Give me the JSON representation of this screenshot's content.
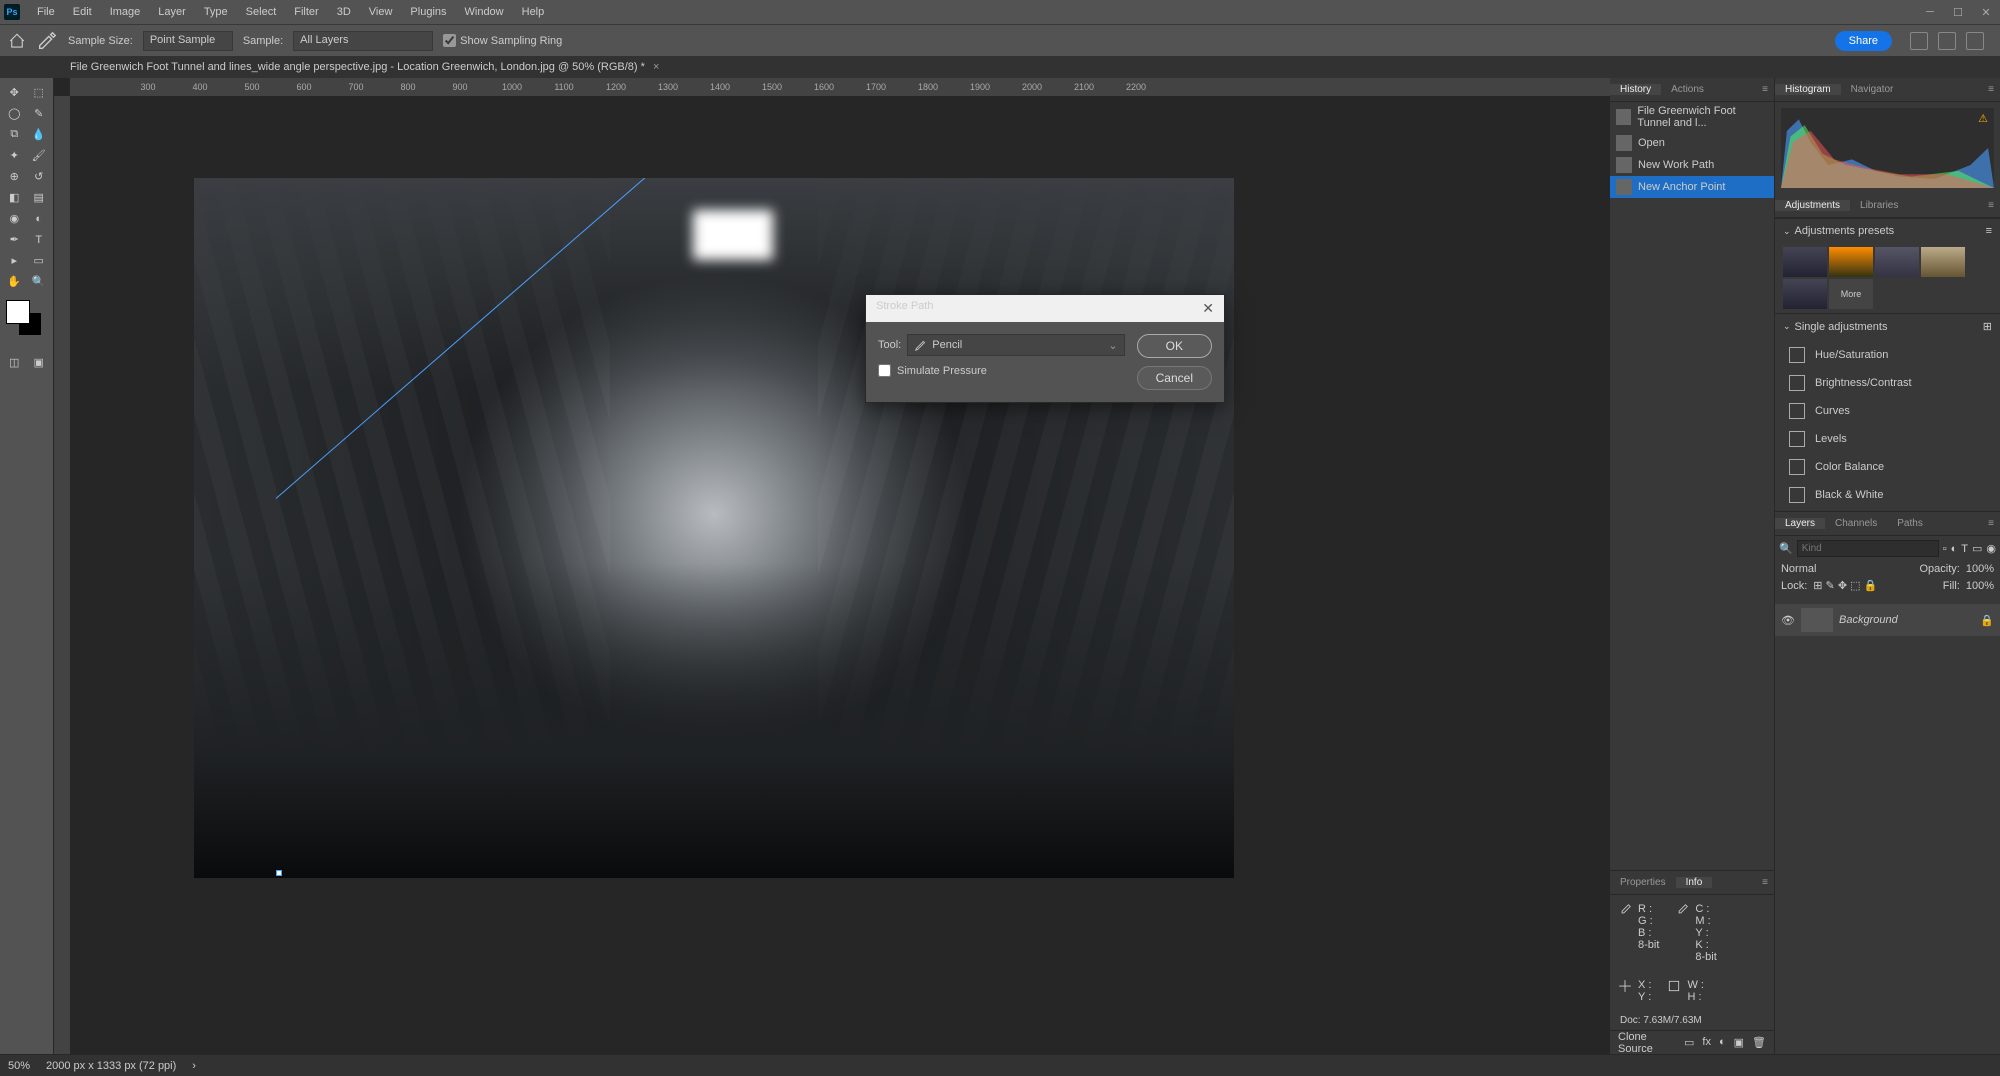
{
  "menu": {
    "items": [
      "File",
      "Edit",
      "Image",
      "Layer",
      "Type",
      "Select",
      "Filter",
      "3D",
      "View",
      "Plugins",
      "Window",
      "Help"
    ]
  },
  "optbar": {
    "sample_size_label": "Sample Size:",
    "sample_size_value": "Point Sample",
    "sample_label": "Sample:",
    "sample_value": "All Layers",
    "show_ring": "Show Sampling Ring",
    "share": "Share"
  },
  "doc": {
    "title": "File Greenwich Foot Tunnel and lines_wide angle perspective.jpg - Location Greenwich, London.jpg @ 50% (RGB/8) *"
  },
  "ruler_marks": [
    "",
    "300",
    "400",
    "500",
    "600",
    "700",
    "800",
    "900",
    "1000",
    "1100",
    "1200",
    "1300",
    "1400",
    "1500",
    "1600",
    "1700",
    "1800",
    "1900",
    "2000",
    "2100",
    "2200"
  ],
  "dialog": {
    "title": "Stroke Path",
    "tool_label": "Tool:",
    "tool_value": "Pencil",
    "simulate": "Simulate Pressure",
    "ok": "OK",
    "cancel": "Cancel"
  },
  "panels": {
    "history_tab": "History",
    "actions_tab": "Actions",
    "histogram_tab": "Histogram",
    "navigator_tab": "Navigator",
    "adjustments_tab": "Adjustments",
    "libraries_tab": "Libraries",
    "properties_tab": "Properties",
    "info_tab": "Info",
    "layers_tab": "Layers",
    "channels_tab": "Channels",
    "paths_tab": "Paths",
    "clone_source": "Clone Source"
  },
  "history": {
    "file": "File Greenwich Foot Tunnel and l...",
    "items": [
      "Open",
      "New Work Path",
      "New Anchor Point"
    ]
  },
  "adj_presets_hdr": "Adjustments presets",
  "single_adj_hdr": "Single adjustments",
  "more": "More",
  "adjustments": [
    "Hue/Saturation",
    "Brightness/Contrast",
    "Curves",
    "Levels",
    "Color Balance",
    "Black & White"
  ],
  "layers": {
    "kind": "Kind",
    "blend": "Normal",
    "opacity_label": "Opacity:",
    "opacity": "100%",
    "lock_label": "Lock:",
    "fill_label": "Fill:",
    "fill": "100%",
    "bg": "Background"
  },
  "info": {
    "rgb": [
      "R :",
      "G :",
      "B :"
    ],
    "cmyk": [
      "C :",
      "M :",
      "Y :",
      "K :"
    ],
    "bit": "8-bit",
    "xy": [
      "X :",
      "Y :"
    ],
    "wh": [
      "W :",
      "H :"
    ],
    "doc": "Doc: 7.63M/7.63M"
  },
  "status": {
    "zoom": "50%",
    "dim": "2000 px x 1333 px (72 ppi)"
  }
}
